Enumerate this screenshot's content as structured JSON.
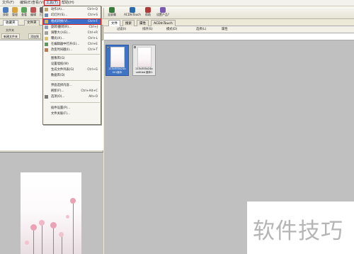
{
  "menubar": {
    "items": [
      {
        "label": "文件(F)"
      },
      {
        "label": "编辑(E)"
      },
      {
        "label": "查看(V)"
      },
      {
        "label": "工具(T)"
      },
      {
        "label": "帮助(H)"
      }
    ]
  },
  "toolbar": {
    "buttons": [
      {
        "label": "获取",
        "icon": "camera-icon",
        "color": "#4a7bbf"
      },
      {
        "label": "管理",
        "icon": "folder-icon",
        "color": "#d9a23a"
      },
      {
        "label": "查看",
        "icon": "eye-icon",
        "color": "#5aa35a"
      },
      {
        "label": "编辑",
        "icon": "pencil-icon",
        "color": "#c05050"
      },
      {
        "label": "打印",
        "icon": "printer-icon",
        "color": "#666666"
      }
    ],
    "right_buttons": [
      {
        "label": "全屏幕",
        "icon": "fullscreen-icon",
        "color": "#3a7a3a"
      },
      {
        "label": "ACDInTouch",
        "icon": "acd-icon",
        "color": "#2a6ab0"
      },
      {
        "label": "帮助",
        "icon": "help-icon",
        "color": "#b03a3a"
      },
      {
        "label": "设置产品?",
        "icon": "settings-icon",
        "color": "#7a5ab0"
      }
    ]
  },
  "left": {
    "tabs": [
      "收藏夹",
      "文件夹"
    ],
    "row_label": "文件夹",
    "buttons": [
      "新建文件夹",
      "添加到"
    ]
  },
  "right": {
    "tabs": [
      "文件",
      "搜索",
      "属性",
      "ACDInTouch"
    ],
    "toolbar": [
      "过滤(I)",
      "排序(S)",
      "模式(D)",
      "选择(L)",
      "属性"
    ],
    "thumbnails": [
      {
        "caption": "215x300x24b",
        "caption2": "001副本",
        "selected": true
      },
      {
        "caption": "215x300x24b",
        "caption2": "untitled 副本1",
        "selected": false
      }
    ]
  },
  "dropdown": {
    "items": [
      {
        "label": "动作(A)...",
        "shortcut": "Ctrl+Q"
      },
      {
        "label": "幻灯片(S)...",
        "shortcut": "Ctrl+S"
      },
      {
        "label": "格式转换(V)...",
        "shortcut": "Ctrl+F",
        "highlighted": true
      },
      {
        "label": "旋转/翻转(R)...",
        "shortcut": "Ctrl+J"
      },
      {
        "label": "调整大小(E)...",
        "shortcut": "Ctrl+R"
      },
      {
        "label": "曝光(X)...",
        "shortcut": "Ctrl+L"
      },
      {
        "label": "在编辑器中打开(E)...",
        "shortcut": "Ctrl+E"
      },
      {
        "label": "改变时间戳(I)...",
        "shortcut": "Ctrl+T"
      },
      {
        "label": "图像库(G)",
        "shortcut": ""
      },
      {
        "label": "设置墙纸(W)",
        "shortcut": ""
      },
      {
        "label": "生成文件列表(G)",
        "shortcut": "Ctrl+G"
      },
      {
        "label": "数据库(D)",
        "shortcut": ""
      },
      {
        "label": "界面选择内容...",
        "shortcut": ""
      },
      {
        "label": "刷新(F)...",
        "shortcut": "Ctrl+Alt+C"
      },
      {
        "label": "选项(O)...",
        "shortcut": "Alt+O"
      },
      {
        "label": "插件设置(P)...",
        "shortcut": ""
      },
      {
        "label": "文件关联(F)...",
        "shortcut": ""
      }
    ]
  },
  "watermark": {
    "text": "软件技巧"
  }
}
